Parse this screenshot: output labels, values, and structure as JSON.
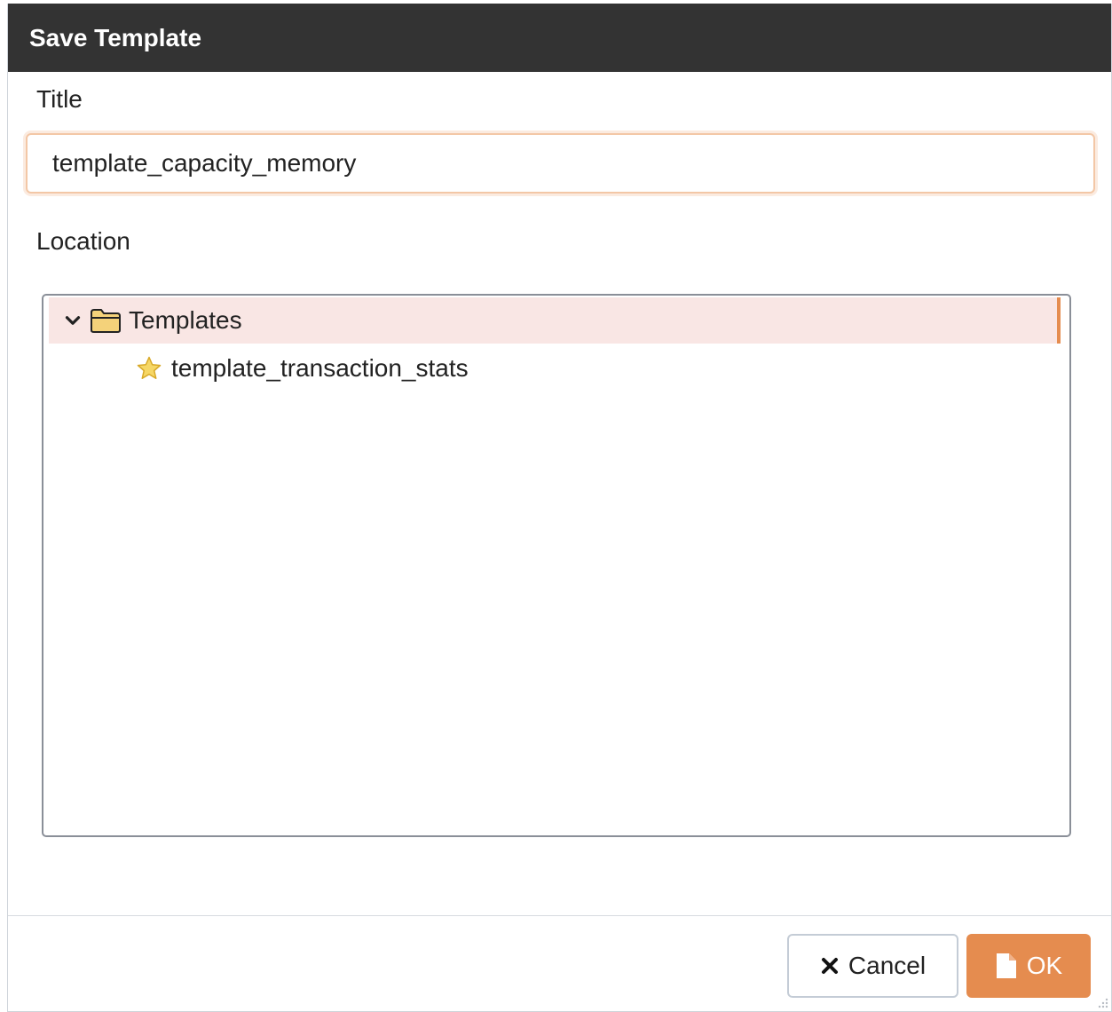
{
  "dialog": {
    "title": "Save Template"
  },
  "form": {
    "title_label": "Title",
    "title_value": "template_capacity_memory",
    "location_label": "Location"
  },
  "tree": {
    "root": {
      "label": "Templates",
      "icon": "folder-icon",
      "expanded": true,
      "selected": true
    },
    "children": [
      {
        "label": "template_transaction_stats",
        "icon": "star-icon"
      }
    ]
  },
  "buttons": {
    "cancel_label": "Cancel",
    "ok_label": "OK"
  },
  "colors": {
    "titlebar": "#333333",
    "accent": "#e58c4f",
    "selection": "#f9e6e4"
  }
}
